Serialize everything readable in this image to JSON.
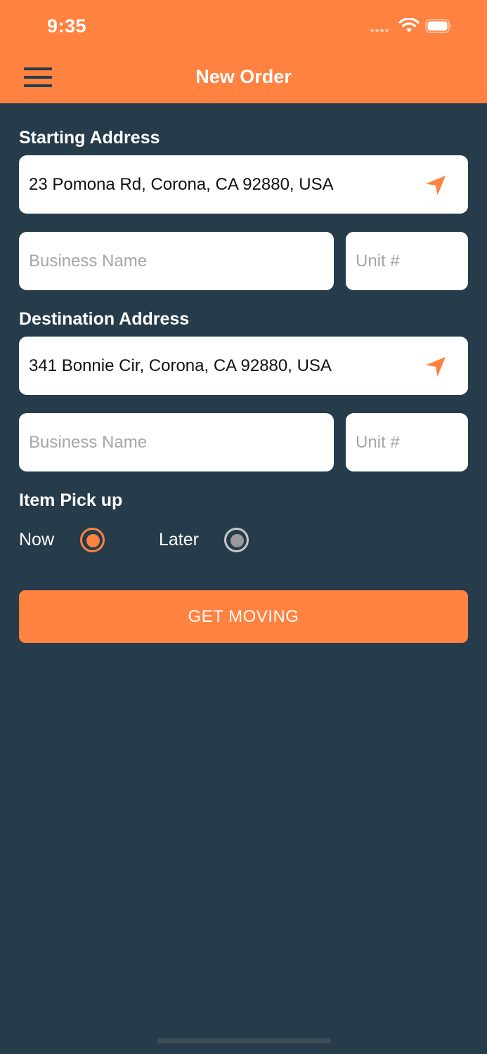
{
  "status_bar": {
    "time": "9:35"
  },
  "header": {
    "title": "New Order"
  },
  "starting": {
    "label": "Starting Address",
    "address_value": "23 Pomona Rd, Corona, CA 92880, USA",
    "business_placeholder": "Business Name",
    "unit_placeholder": "Unit #"
  },
  "destination": {
    "label": "Destination Address",
    "address_value": "341 Bonnie Cir, Corona, CA 92880, USA",
    "business_placeholder": "Business Name",
    "unit_placeholder": "Unit #"
  },
  "pickup": {
    "label": "Item Pick up",
    "options": [
      {
        "label": "Now",
        "selected": true
      },
      {
        "label": "Later",
        "selected": false
      }
    ]
  },
  "action": {
    "label": "GET MOVING"
  },
  "colors": {
    "accent": "#ff8240",
    "background": "#263c4b",
    "field": "#ffffff"
  }
}
